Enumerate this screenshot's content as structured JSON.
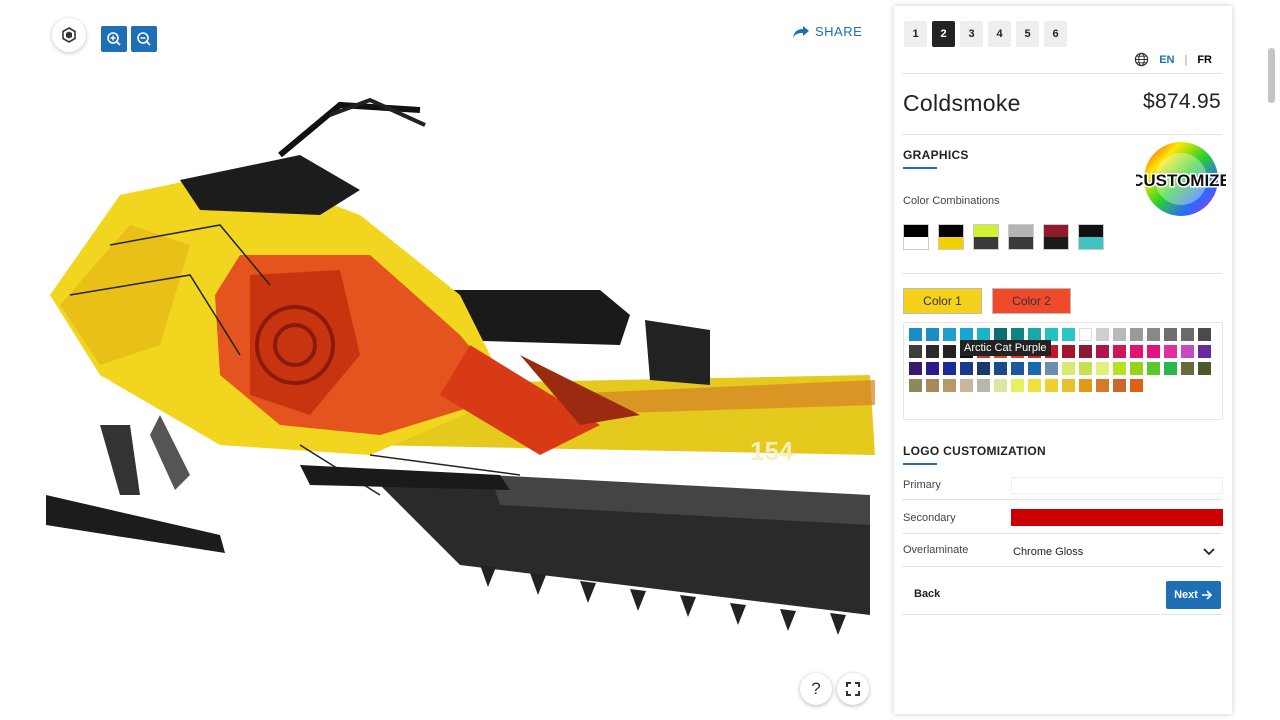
{
  "toolbar": {
    "share_label": "SHARE"
  },
  "steps": [
    "1",
    "2",
    "3",
    "4",
    "5",
    "6"
  ],
  "active_step": "2",
  "lang": {
    "en": "EN",
    "separator": "|",
    "fr": "FR"
  },
  "product": {
    "name": "Coldsmoke",
    "price": "$874.95"
  },
  "graphics": {
    "heading": "GRAPHICS",
    "customize_badge": "CUSTOMIZE",
    "combos_label": "Color Combinations",
    "combos": [
      [
        "#000000",
        "#ffffff"
      ],
      [
        "#000000",
        "#f0d000"
      ],
      [
        "#d4f036",
        "#3a3a3a"
      ],
      [
        "#b5b5b5",
        "#3a3a3a"
      ],
      [
        "#8e1a2c",
        "#1a1a1a"
      ],
      [
        "#111111",
        "#3fc2c0"
      ]
    ],
    "color1_label": "Color 1",
    "color1_value": "#f4d21c",
    "color2_label": "Color 2",
    "color2_value": "#ef4a2a",
    "tooltip": "Arctic Cat Purple",
    "palette": [
      "#1a8fc6",
      "#1a8fc6",
      "#1f9fd0",
      "#16a7d1",
      "#1ab4c8",
      "#0d6e73",
      "#0e8485",
      "#18a9a7",
      "#1fc1c1",
      "#28c7c7",
      "#ffffff",
      "#cfcfcf",
      "#b8b8b8",
      "#9a9a9a",
      "#888888",
      "#6f6f6f",
      "#6a6a6a",
      "#4a4a4a",
      "#3d3d3d",
      "#2a2a2a",
      "#222222",
      "#111111",
      "#d23232",
      "#e0481c",
      "#e83a28",
      "#d8202a",
      "#c4182a",
      "#a4152c",
      "#8a1a36",
      "#b0144a",
      "#d0145a",
      "#e01470",
      "#e0147f",
      "#e030a0",
      "#c84ac0",
      "#6a2a9c",
      "#3a1a6a",
      "#2a1a8a",
      "#1a2a9a",
      "#1a3a8a",
      "#1a3a6a",
      "#1a4a8a",
      "#1a5a9a",
      "#1a6ab0",
      "#6c8ea8",
      "#d8e870",
      "#c8e050",
      "#e0f07a",
      "#b8e022",
      "#9ad21a",
      "#5ac82a",
      "#2ab84a",
      "#6a6a3a",
      "#4a5a2a",
      "#8a8a5a",
      "#a88a5a",
      "#b89a6a",
      "#c8b8a0",
      "#b8b8a8",
      "#d8e8a0",
      "#e8f060",
      "#f0e040",
      "#f0d030",
      "#e8c028",
      "#e09a1a",
      "#d8782a",
      "#c8682a",
      "#e0601a"
    ]
  },
  "logo": {
    "heading": "LOGO CUSTOMIZATION",
    "primary_label": "Primary",
    "primary_value": "#ffffff",
    "secondary_label": "Secondary",
    "secondary_value": "#cc0000",
    "overlaminate_label": "Overlaminate",
    "overlaminate_value": "Chrome Gloss"
  },
  "nav": {
    "back_label": "Back",
    "next_label": "Next"
  },
  "viewer": {
    "help_label": "?"
  }
}
